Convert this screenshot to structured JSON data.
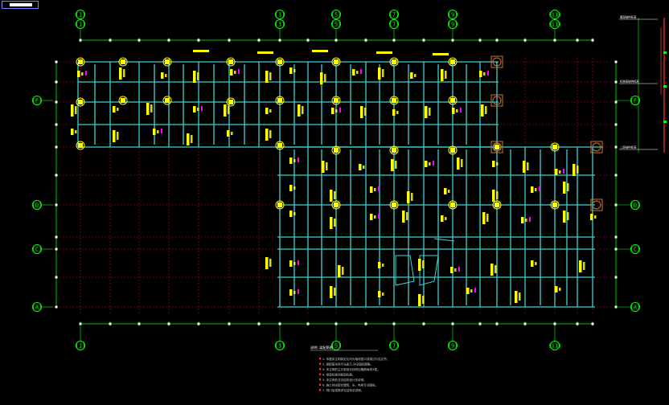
{
  "window": {
    "title_tab": ""
  },
  "drawing": {
    "colors": {
      "background": "#000000",
      "grid": "#cc0000",
      "beam": "#3fd0d0",
      "column": "#ffff00",
      "annotation": "#ffff00",
      "annotation_alt": "#ff00ff",
      "dimension": "#00ff00",
      "axis_bubble": "#00ff00"
    },
    "top_axis_labels": [
      "(1)",
      "(3)",
      "(5)",
      "(7)",
      "(9)",
      "(11)"
    ],
    "bottom_axis_labels": [
      "(1)",
      "(3)",
      "(5)",
      "(7)",
      "(9)",
      "(11)"
    ],
    "left_axis_labels": [
      "(F)",
      "(D)",
      "(C)",
      "(A)"
    ],
    "right_axis_labels": [
      "(F)",
      "(D)",
      "(C)",
      "(A)"
    ],
    "notes_heading": "说明: 梁配筋图",
    "notes_lines": [
      "1. 本图未注明梁定位均为轴线居中或梁边与柱边齐。",
      "2. 梁配筋采用平法表示,详见国标图集。",
      "3. 未注明的主次梁相交处附加箍筋每侧3根。",
      "4. 梁面标高同板面标高。",
      "5. 未注明处详见结构设计总说明。",
      "6. 施工时应配合建筑、水、电各专业图纸。",
      "7. 洞口加强筋详见结构总说明。"
    ],
    "section_labels": [
      "屋面结构标高",
      "标准层结构标高",
      "二层结构标高"
    ]
  }
}
